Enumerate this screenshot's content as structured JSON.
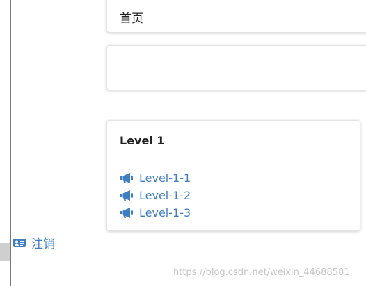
{
  "header_card": {
    "title": "首页"
  },
  "menu_card": {
    "title": "Level 1",
    "items": [
      {
        "label": "Level-1-1",
        "icon": "bullhorn-icon"
      },
      {
        "label": "Level-1-2",
        "icon": "bullhorn-icon"
      },
      {
        "label": "Level-1-3",
        "icon": "bullhorn-icon"
      }
    ]
  },
  "sidebar": {
    "logout_label": "注销",
    "logout_icon": "id-card-icon"
  },
  "watermark": "https://blog.csdn.net/weixin_44688581",
  "colors": {
    "link": "#3f7fc1",
    "text": "#222222",
    "divider": "#8c8c8c"
  }
}
